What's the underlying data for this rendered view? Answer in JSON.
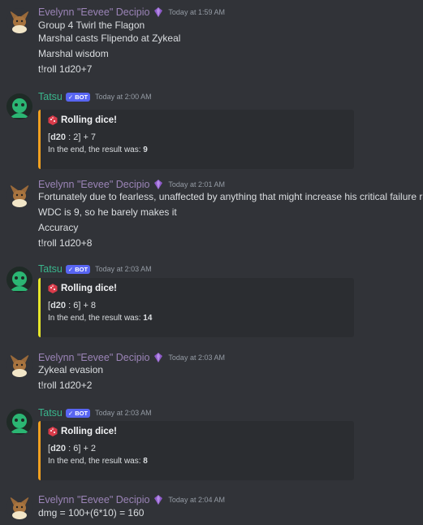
{
  "users": {
    "evee": {
      "name": "Evelynn \"Eevee\" Decipio"
    },
    "tatsu": {
      "name": "Tatsu",
      "bot_tag": "✓ BOT"
    }
  },
  "messages": [
    {
      "author": "Evelynn \"Eevee\" Decipio",
      "timestamp": "Today at 1:59 AM",
      "lines": [
        "Group 4 Twirl the Flagon",
        "Marshal casts Flipendo at Zykeal",
        "Marshal wisdom",
        "t!roll 1d20+7"
      ]
    },
    {
      "author": "Tatsu",
      "timestamp": "Today at 2:00 AM",
      "embed": {
        "title": "Rolling dice!",
        "die": "d20",
        "roll": "2",
        "modifier": "+ 7",
        "result_label": "In the end, the result was:",
        "result": "9",
        "bar_color": "#f0a020"
      }
    },
    {
      "author": "Evelynn \"Eevee\" Decipio",
      "timestamp": "Today at 2:01 AM",
      "lines": [
        "Fortunately due to fearless, unaffected by anything that might increase his critical failure range",
        "WDC is 9, so he barely makes it",
        "Accuracy",
        "t!roll 1d20+8"
      ]
    },
    {
      "author": "Tatsu",
      "timestamp": "Today at 2:03 AM",
      "embed": {
        "title": "Rolling dice!",
        "die": "d20",
        "roll": "6",
        "modifier": "+ 8",
        "result_label": "In the end, the result was:",
        "result": "14",
        "bar_color": "#e5e52a"
      }
    },
    {
      "author": "Evelynn \"Eevee\" Decipio",
      "timestamp": "Today at 2:03 AM",
      "lines": [
        "Zykeal evasion",
        "t!roll 1d20+2"
      ]
    },
    {
      "author": "Tatsu",
      "timestamp": "Today at 2:03 AM",
      "embed": {
        "title": "Rolling dice!",
        "die": "d20",
        "roll": "6",
        "modifier": "+ 2",
        "result_label": "In the end, the result was:",
        "result": "8",
        "bar_color": "#f0a020"
      }
    },
    {
      "author": "Evelynn \"Eevee\" Decipio",
      "timestamp": "Today at 2:04 AM",
      "lines": [
        "dmg = 100+(6*10) = 160"
      ]
    }
  ],
  "icons": {
    "evee_avatar": "eevee-avatar",
    "tatsu_avatar": "tatsu-avatar",
    "role": "purple-gem-icon",
    "die": "red-die-icon"
  }
}
